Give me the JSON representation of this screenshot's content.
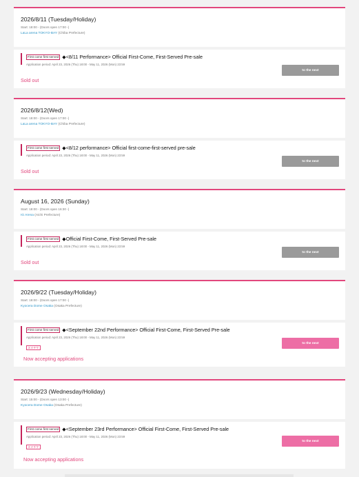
{
  "events": [
    {
      "title": "2026/8/11 (Tuesday/Holiday)",
      "start": "Start: 18:00 - (Doors open 17:00 -)",
      "venue_name": "LaLa arena TOKYO-BAY",
      "venue_pref": "(Chiba Prefecture)",
      "sale": {
        "badge": "First come first served",
        "title": "◆<8/11 Performance> Official First-Come, First-Served Pre-sale",
        "period": "Application period: April 23, 2026 (Thu) 18:00 - May 11, 2026 (Mon) 23:59",
        "status": "Sold out",
        "button": "to the next"
      }
    },
    {
      "title": "2026/8/12(Wed)",
      "start": "Start: 18:00 - (Doors open 17:00 -)",
      "venue_name": "LaLa arena TOKYO-BAY",
      "venue_pref": "(Chiba Prefecture)",
      "sale": {
        "badge": "First come first served",
        "title": "◆<8/12 performance> Official first-come-first-served pre-sale",
        "period": "Application period: April 23, 2026 (Thu) 18:00 - May 11, 2026 (Mon) 23:59",
        "status": "Sold out",
        "button": "to the next"
      }
    },
    {
      "title": "August 16, 2026 (Sunday)",
      "start": "Start: 18:00 - (Doors open 16:30 -)",
      "venue_name": "IG Arena",
      "venue_pref": "(Aichi Prefecture)",
      "sale": {
        "badge": "First come first served",
        "title": "◆Official First-Come, First-Served Pre-sale",
        "period": "Application period: April 23, 2026 (Thu) 18:00 - May 11, 2026 (Mon) 23:59",
        "status": "Sold out",
        "button": "to the next"
      }
    },
    {
      "title": "2026/9/22 (Tuesday/Holiday)",
      "start": "Start: 18:00 - (Doors open 17:00 -)",
      "venue_name": "Kyocera Dome Osaka",
      "venue_pref": "(Osaka Prefecture)",
      "sale": {
        "badge": "First come first served",
        "title": "◆<September 22nd Performance> Official First-Come, First-Served Pre-sale",
        "period": "Application period: April 23, 2026 (Thu) 18:00 - May 11, 2026 (Mon) 23:59",
        "tag": "スマチケ",
        "status": "Now accepting applications",
        "button": "to the next"
      }
    },
    {
      "title": "2026/9/23 (Wednesday/Holiday)",
      "start": "Start: 15:00 - (Doors open 13:00 -)",
      "venue_name": "Kyocera Dome Osaka",
      "venue_pref": "(Osaka Prefecture)",
      "sale": {
        "badge": "First come first served",
        "title": "◆<September 23rd Performance> Official First-Come, First-Served Pre-sale",
        "period": "Application period: April 23, 2026 (Thu) 18:00 - May 11, 2026 (Mon) 23:59",
        "tag": "スマチケ",
        "status": "Now accepting applications",
        "button": "to the next"
      }
    }
  ]
}
